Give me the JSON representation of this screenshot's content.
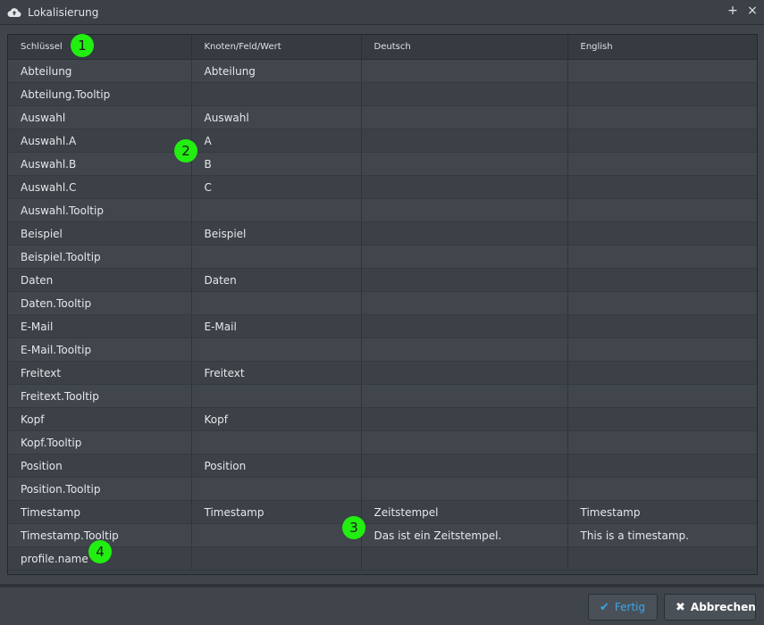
{
  "window": {
    "title": "Lokalisierung",
    "icon": "cloud-upload-icon",
    "add_label": "+",
    "close_label": "×"
  },
  "table": {
    "columns": [
      "Schlüssel",
      "Knoten/Feld/Wert",
      "Deutsch",
      "English"
    ],
    "rows": [
      [
        "Abteilung",
        "Abteilung",
        "",
        ""
      ],
      [
        "Abteilung.Tooltip",
        "",
        "",
        ""
      ],
      [
        "Auswahl",
        "Auswahl",
        "",
        ""
      ],
      [
        "Auswahl.A",
        "A",
        "",
        ""
      ],
      [
        "Auswahl.B",
        "B",
        "",
        ""
      ],
      [
        "Auswahl.C",
        "C",
        "",
        ""
      ],
      [
        "Auswahl.Tooltip",
        "",
        "",
        ""
      ],
      [
        "Beispiel",
        "Beispiel",
        "",
        ""
      ],
      [
        "Beispiel.Tooltip",
        "",
        "",
        ""
      ],
      [
        "Daten",
        "Daten",
        "",
        ""
      ],
      [
        "Daten.Tooltip",
        "",
        "",
        ""
      ],
      [
        "E-Mail",
        "E-Mail",
        "",
        ""
      ],
      [
        "E-Mail.Tooltip",
        "",
        "",
        ""
      ],
      [
        "Freitext",
        "Freitext",
        "",
        ""
      ],
      [
        "Freitext.Tooltip",
        "",
        "",
        ""
      ],
      [
        "Kopf",
        "Kopf",
        "",
        ""
      ],
      [
        "Kopf.Tooltip",
        "",
        "",
        ""
      ],
      [
        "Position",
        "Position",
        "",
        ""
      ],
      [
        "Position.Tooltip",
        "",
        "",
        ""
      ],
      [
        "Timestamp",
        "Timestamp",
        "Zeitstempel",
        "Timestamp"
      ],
      [
        "Timestamp.Tooltip",
        "",
        "Das ist ein Zeitstempel.",
        "This is a timestamp."
      ],
      [
        "profile.name",
        "",
        "",
        ""
      ]
    ]
  },
  "markers": [
    "1",
    "2",
    "3",
    "4"
  ],
  "footer": {
    "ok_label": "Fertig",
    "cancel_label": "Abbrechen",
    "ok_icon": "checkmark-icon",
    "cancel_icon": "x-icon"
  },
  "colors": {
    "accent": "#3ba6ea",
    "marker": "#22ee11"
  }
}
